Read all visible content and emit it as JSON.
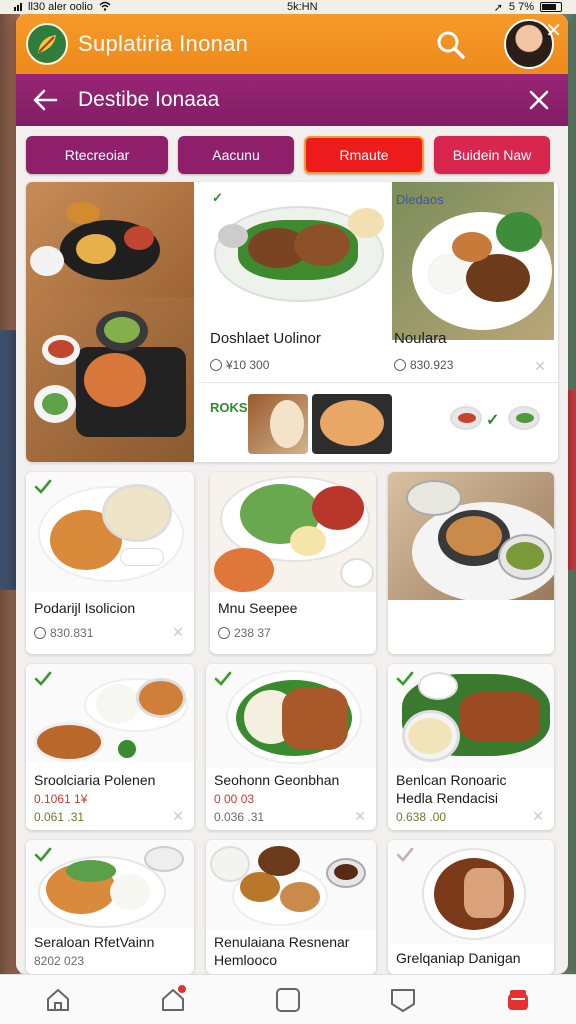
{
  "status_bar": {
    "carrier": "ll30 aler oolio",
    "time": "5k:HN",
    "battery": "5 7%"
  },
  "header": {
    "title": "Suplatiria Inonan",
    "icons": {
      "logo": "leaf-logo-icon",
      "search": "search-icon",
      "avatar": "user-avatar",
      "close": "close-icon"
    }
  },
  "subheader": {
    "title": "Destibe Ionaaa",
    "icons": {
      "back": "back-arrow-icon",
      "close": "close-icon"
    }
  },
  "chips": [
    {
      "label": "Rtecreoiar",
      "color": "#8f1f6b"
    },
    {
      "label": "Aacunu",
      "color": "#8f1f6b"
    },
    {
      "label": "Rmaute",
      "color": "#ec1c1c"
    },
    {
      "label": "Buidein Naw",
      "color": "#d8264f"
    }
  ],
  "feature": {
    "tag_left": "✓",
    "tag_right": "Dledaos",
    "item1": {
      "name": "Doshlaet Uolinor",
      "price": "¥10 300"
    },
    "item2": {
      "name": "Noulara",
      "price": "830.923"
    },
    "bottom_tag": "ROKS"
  },
  "cards": [
    {
      "name": "Podarijl Isolicion",
      "price": "830.831"
    },
    {
      "name": "Mnu Seepee",
      "price": "238 37"
    },
    {
      "name": "Sroolciaria Polenen",
      "price": "0.1061 1¥",
      "price2": "0.061 .31"
    },
    {
      "name": "Seohonn Geonbhan",
      "price": "0 00 03",
      "price2": "0.036 .31"
    },
    {
      "name": "Benlcan Ronoaric",
      "name2": "Hedla Rendacisi",
      "price": "0.638 .00"
    },
    {
      "name": "Seraloan RfetVainn",
      "price": "8202 023"
    },
    {
      "name": "Renulaiana Resnenar",
      "name2": "Hemlooco"
    },
    {
      "name": "Grelqaniap Danigan"
    }
  ],
  "bottom_nav": [
    {
      "icon": "home-icon"
    },
    {
      "icon": "notification-house-icon",
      "badge": true
    },
    {
      "icon": "square-icon"
    },
    {
      "icon": "chat-icon"
    },
    {
      "icon": "bag-icon",
      "accent": "#e53030"
    }
  ]
}
